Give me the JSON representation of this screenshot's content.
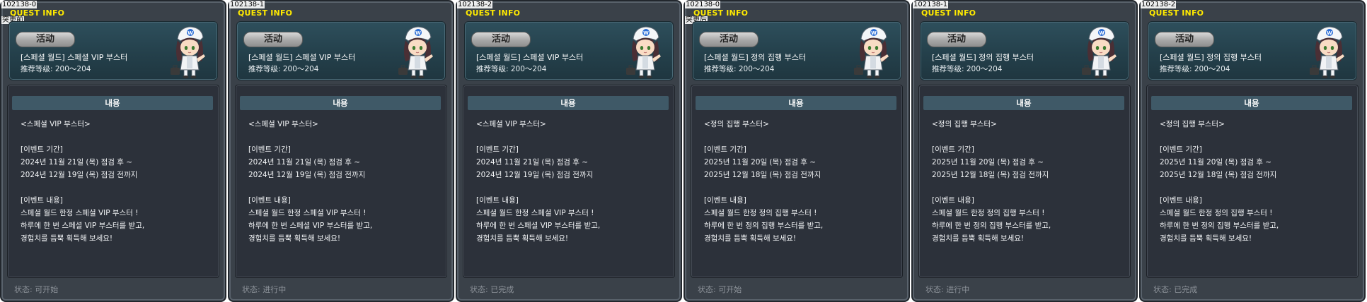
{
  "panels": [
    {
      "id": "102138-0",
      "title": "QUEST INFO",
      "subtitle": "突更前",
      "tag": "活动",
      "quest_name": "[스페셜 월드] 스페셜 VIP 부스터",
      "level": "推荐等级: 200～204",
      "content_header": "내용",
      "lines": [
        "<스페셜 VIP 부스터>",
        "",
        "[이벤트 기간]",
        "2024년 11월 21일 (목) 점검 후 ~",
        "2024년 12월 19일 (목) 점검 전까지",
        "",
        "[이벤트 내용]",
        "스페셜 월드 한정 스페셜 VIP 부스터 !",
        "하루에 한 번 스페셜 VIP 부스터를 받고,",
        "경험치를 듬뿍 획득해 보세요!"
      ],
      "status": "状态:  可开始"
    },
    {
      "id": "102138-1",
      "title": "QUEST INFO",
      "subtitle": "",
      "tag": "活动",
      "quest_name": "[스페셜 월드] 스페셜 VIP 부스터",
      "level": "推荐等级: 200～204",
      "content_header": "내용",
      "lines": [
        "<스페셜 VIP 부스터>",
        "",
        "[이벤트 기간]",
        "2024년 11월 21일 (목) 점검 후 ~",
        "2024년 12월 19일 (목) 점검 전까지",
        "",
        "[이벤트 내용]",
        "스페셜 월드 한정 스페셜 VIP 부스터 !",
        "하루에 한 번 스페셜 VIP 부스터를 받고,",
        "경험치를 듬뿍 획득해 보세요!"
      ],
      "status": "状态:  进行中"
    },
    {
      "id": "102138-2",
      "title": "QUEST INFO",
      "subtitle": "",
      "tag": "活动",
      "quest_name": "[스페셜 월드] 스페셜 VIP 부스터",
      "level": "推荐等级: 200～204",
      "content_header": "내용",
      "lines": [
        "<스페셜 VIP 부스터>",
        "",
        "[이벤트 기간]",
        "2024년 11월 21일 (목) 점검 후 ~",
        "2024년 12월 19일 (목) 점검 전까지",
        "",
        "[이벤트 내용]",
        "스페셜 월드 한정 스페셜 VIP 부스터 !",
        "하루에 한 번 스페셜 VIP 부스터를 받고,",
        "경험치를 듬뿍 획득해 보세요!"
      ],
      "status": "状态:  已完成"
    },
    {
      "id": "102138-0",
      "title": "QUEST INFO",
      "subtitle": "突更后",
      "tag": "活动",
      "quest_name": "[스페셜 월드] 정의 집행 부스터",
      "level": "推荐等级: 200～204",
      "content_header": "내용",
      "lines": [
        "<정의 집행 부스터>",
        "",
        "[이벤트 기간]",
        "2025년 11월 20일 (목) 점검 후 ~",
        "2025년 12월 18일 (목) 점검 전까지",
        "",
        "[이벤트 내용]",
        "스페셜 월드 한정 정의 집행 부스터 !",
        "하루에 한 번 정의 집행 부스터를 받고,",
        "경험치를 듬뿍 획득해 보세요!"
      ],
      "status": "状态:  可开始"
    },
    {
      "id": "102138-1",
      "title": "QUEST INFO",
      "subtitle": "",
      "tag": "活动",
      "quest_name": "[스페셜 월드] 정의 집행 부스터",
      "level": "推荐等级: 200～204",
      "content_header": "내용",
      "lines": [
        "<정의 집행 부스터>",
        "",
        "[이벤트 기간]",
        "2025년 11월 20일 (목) 점검 후 ~",
        "2025년 12월 18일 (목) 점검 전까지",
        "",
        "[이벤트 내용]",
        "스페셜 월드 한정 정의 집행 부스터 !",
        "하루에 한 번 정의 집행 부스터를 받고,",
        "경험치를 듬뿍 획득해 보세요!"
      ],
      "status": "状态:  进行中"
    },
    {
      "id": "102138-2",
      "title": "QUEST INFO",
      "subtitle": "",
      "tag": "活动",
      "quest_name": "[스페셜 월드] 정의 집행 부스터",
      "level": "推荐等级: 200～204",
      "content_header": "내용",
      "lines": [
        "<정의 집행 부스터>",
        "",
        "[이벤트 기간]",
        "2025년 11월 20일 (목) 점검 후 ~",
        "2025년 12월 18일 (목) 점검 전까지",
        "",
        "[이벤트 내용]",
        "스페셜 월드 한정 정의 집행 부스터 !",
        "하루에 한 번 정의 집행 부스터를 받고,",
        "경험치를 듬뿍 획득해 보세요!"
      ],
      "status": "状态:  已完成"
    }
  ],
  "icons": {
    "npc": "npc-portrait-icon",
    "logo": "w-logo"
  },
  "colors": {
    "title": "#ffea00",
    "panel_bg": "#3a4149",
    "header_bg": "#24404b",
    "content_header_bg": "#3f5967",
    "status_text": "#8d939a"
  }
}
